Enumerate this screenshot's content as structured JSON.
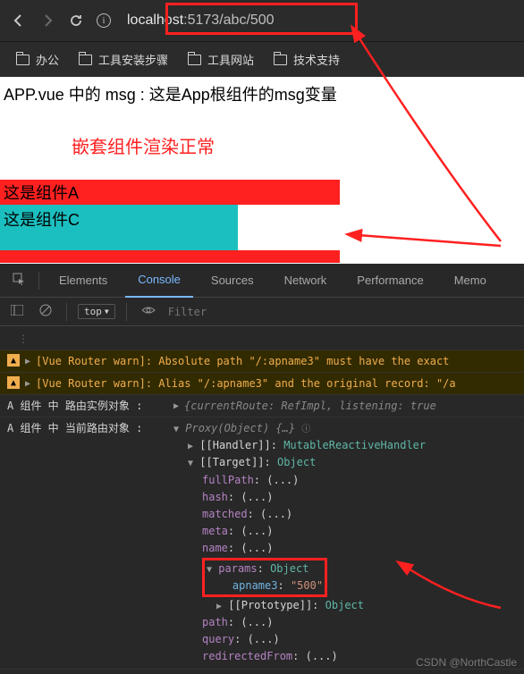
{
  "browser": {
    "url_host": "localhost",
    "url_path": ":5173/abc/500"
  },
  "bookmarks": [
    {
      "label": "办公"
    },
    {
      "label": "工具安装步骤"
    },
    {
      "label": "工具网站"
    },
    {
      "label": "技术支持"
    }
  ],
  "page": {
    "msg_line": "APP.vue 中的 msg : 这是App根组件的msg变量",
    "nested": "嵌套组件渲染正常",
    "comp_a": "这是组件A",
    "comp_c": "这是组件C"
  },
  "devtools": {
    "tabs": [
      "Elements",
      "Console",
      "Sources",
      "Network",
      "Performance",
      "Memo"
    ],
    "active_tab": "Console",
    "filter": {
      "context": "top",
      "placeholder": "Filter"
    },
    "warnings": [
      "[Vue Router warn]: Absolute path \"/:apname3\" must have the exact ",
      "[Vue Router warn]: Alias \"/:apname3\" and the original record: \"/a"
    ],
    "logs": [
      {
        "label": "A 组件 中 路由实例对象 :",
        "head": "{currentRoute: RefImpl, listening: true"
      },
      {
        "label": "A 组件 中 当前路由对象 :",
        "proxy": "Proxy(Object) {…}",
        "handler": "MutableReactiveHandler",
        "target": "Object",
        "props": {
          "fullPath": "(...)",
          "hash": "(...)",
          "matched": "(...)",
          "meta": "(...)",
          "name": "(...)",
          "params_type": "Object",
          "apname3": "\"500\"",
          "proto": "Object",
          "path": "(...)",
          "query": "(...)",
          "redirectedFrom": "(...)"
        }
      }
    ]
  },
  "watermark": "CSDN @NorthCastle"
}
